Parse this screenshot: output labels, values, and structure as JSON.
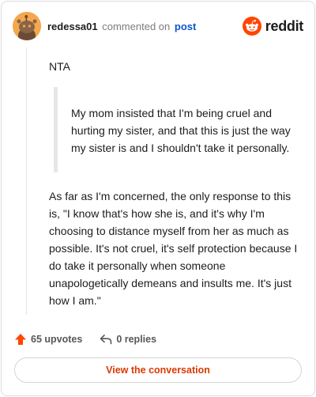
{
  "header": {
    "username": "redessa01",
    "commented_text": "commented on",
    "post_link": "post",
    "brand": "reddit",
    "avatar_icon": "snoo-avatar-icon",
    "brand_icon": "reddit-snoo-icon",
    "brand_color": "#ff4500"
  },
  "comment": {
    "first_line": "NTA",
    "quote": "My mom insisted that I'm being cruel and hurting my sister, and that this is just the way my sister is and I shouldn't take it personally.",
    "paragraph": "As far as I'm concerned, the only response to this is, \"I know that's how she is, and it's why I'm choosing to distance myself from her as much as possible. It's not cruel, it's self protection because I do take it personally when someone unapologetically demeans and insults me. It's just how I am.\""
  },
  "actions": {
    "upvotes": "65 upvotes",
    "replies": "0 replies",
    "upvote_icon": "upvote-arrow-icon",
    "reply_icon": "reply-arrow-icon",
    "upvote_color": "#ff4500"
  },
  "cta": {
    "label": "View the conversation",
    "color": "#d93a00"
  }
}
